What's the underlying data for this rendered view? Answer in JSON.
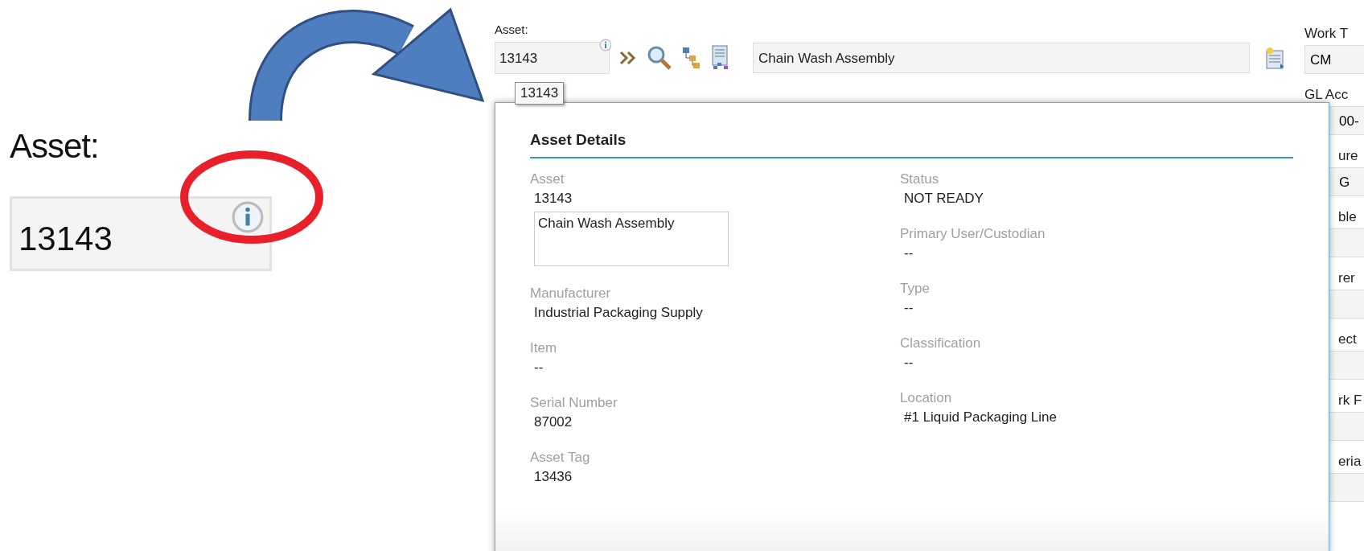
{
  "zoom_inset": {
    "label": "Asset:",
    "value": "13143"
  },
  "form": {
    "asset_label": "Asset:",
    "asset_value": "13143",
    "tooltip": "13143",
    "description": "Chain Wash Assembly",
    "side_fields": [
      {
        "label": "Work T",
        "value": "CM"
      },
      {
        "label": "GL Acc",
        "value": "00-"
      },
      {
        "label": "ure",
        "value": "G"
      },
      {
        "label": "ble"
      },
      {
        "label": "rer"
      },
      {
        "label": "ect"
      },
      {
        "label": "rk F"
      },
      {
        "label": "eria"
      }
    ]
  },
  "popup": {
    "title": "Asset Details",
    "left": [
      {
        "label": "Asset",
        "value": "13143",
        "description": "Chain Wash Assembly"
      },
      {
        "label": "Manufacturer",
        "value": "Industrial Packaging Supply"
      },
      {
        "label": "Item",
        "value": "--"
      },
      {
        "label": "Serial Number",
        "value": "87002"
      },
      {
        "label": "Asset Tag",
        "value": "13436"
      }
    ],
    "right": [
      {
        "label": "Status",
        "value": "NOT READY"
      },
      {
        "label": "Primary User/Custodian",
        "value": "--"
      },
      {
        "label": "Type",
        "value": "--"
      },
      {
        "label": "Classification",
        "value": "--"
      },
      {
        "label": "Location",
        "value": "#1 Liquid Packaging Line"
      }
    ]
  }
}
